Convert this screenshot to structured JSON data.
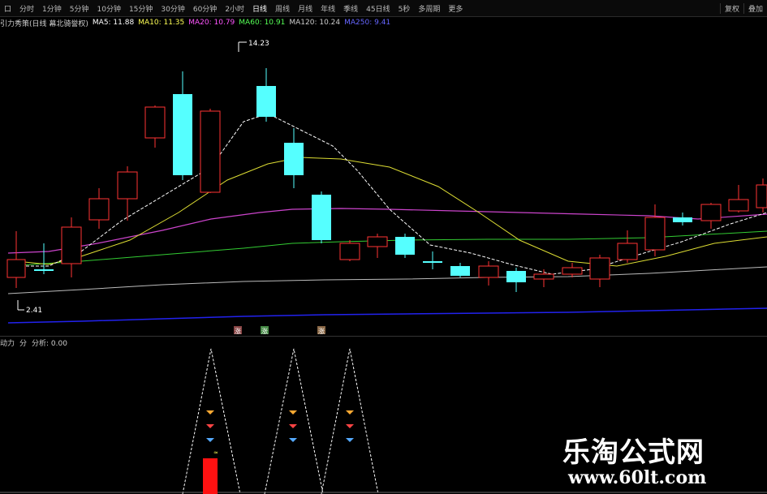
{
  "toolbar": {
    "items": [
      "口",
      "分时",
      "1分钟",
      "5分钟",
      "10分钟",
      "15分钟",
      "30分钟",
      "60分钟",
      "2小时",
      "日线",
      "周线",
      "月线",
      "年线",
      "季线",
      "45日线",
      "5秒",
      "多周期",
      "更多"
    ],
    "active_index": 9,
    "right": [
      "复权",
      "叠加"
    ]
  },
  "ma_bar": {
    "name": "引力秀策(日线 幕北骑誉权)",
    "ma5": "MA5: 11.88",
    "ma10": "MA10: 11.35",
    "ma20": "MA20: 10.79",
    "ma60": "MA60: 10.91",
    "ma120": "MA120: 10.24",
    "ma250": "MA250: 9.41"
  },
  "price_labels": {
    "high": "14.23",
    "low": "2.41"
  },
  "buy_markers": [
    "涨",
    "涨",
    "涨"
  ],
  "sub_bar": {
    "name": "动力",
    "label": "分",
    "value": "分析: 0.00"
  },
  "watermark": {
    "title": "乐淘公式网",
    "url": "www.60lt.com"
  },
  "colors": {
    "up": "#ff3333",
    "down": "#55ffff",
    "ma5": "#ffffff",
    "ma10": "#ffff55",
    "ma20": "#ff55ff",
    "ma60": "#55ff55",
    "ma120": "#cccccc",
    "ma250": "#3333ff"
  }
}
